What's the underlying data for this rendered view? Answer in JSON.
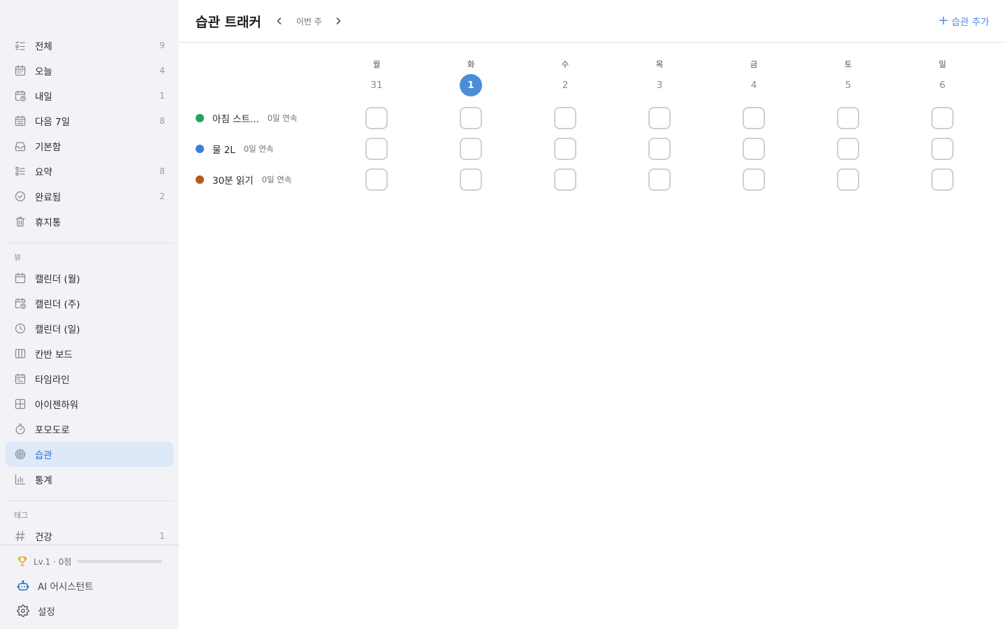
{
  "sidebar": {
    "smart_lists": [
      {
        "label": "전체",
        "count": "9",
        "icon": "checklist-icon"
      },
      {
        "label": "오늘",
        "count": "4",
        "icon": "calendar-today-icon"
      },
      {
        "label": "내일",
        "count": "1",
        "icon": "calendar-clock-icon"
      },
      {
        "label": "다음 7일",
        "count": "8",
        "icon": "calendar-week-icon"
      },
      {
        "label": "기본함",
        "count": "",
        "icon": "inbox-icon"
      },
      {
        "label": "요약",
        "count": "8",
        "icon": "list-icon"
      },
      {
        "label": "완료됨",
        "count": "2",
        "icon": "check-circle-icon"
      },
      {
        "label": "휴지통",
        "count": "",
        "icon": "trash-icon"
      }
    ],
    "views_label": "뷰",
    "views": [
      {
        "label": "캘린더 (월)",
        "icon": "calendar-month-icon"
      },
      {
        "label": "캘린더 (주)",
        "icon": "calendar-week-clock-icon"
      },
      {
        "label": "캘린더 (일)",
        "icon": "clock-icon"
      },
      {
        "label": "칸반 보드",
        "icon": "kanban-icon"
      },
      {
        "label": "타임라인",
        "icon": "timeline-icon"
      },
      {
        "label": "아이젠하워",
        "icon": "matrix-icon"
      },
      {
        "label": "포모도로",
        "icon": "timer-icon"
      },
      {
        "label": "습관",
        "icon": "target-icon",
        "active": true
      },
      {
        "label": "통계",
        "icon": "bar-chart-icon"
      }
    ],
    "tags_label": "태그",
    "tags": [
      {
        "label": "건강",
        "count": "1"
      }
    ],
    "level": {
      "text": "Lv.1 · 0점",
      "progress": 0
    },
    "assistant_label": "AI 어시스턴트",
    "settings_label": "설정"
  },
  "header": {
    "title": "습관 트래커",
    "week_label": "이번 주",
    "add_label": "습관 추가"
  },
  "week": {
    "days": [
      {
        "name": "월",
        "date": "31",
        "today": false
      },
      {
        "name": "화",
        "date": "1",
        "today": true
      },
      {
        "name": "수",
        "date": "2",
        "today": false
      },
      {
        "name": "목",
        "date": "3",
        "today": false
      },
      {
        "name": "금",
        "date": "4",
        "today": false
      },
      {
        "name": "토",
        "date": "5",
        "today": false
      },
      {
        "name": "일",
        "date": "6",
        "today": false
      }
    ]
  },
  "habits": [
    {
      "name": "아침 스트...",
      "streak": "0일 연속",
      "color": "#22a55a",
      "checks": [
        false,
        false,
        false,
        false,
        false,
        false,
        false
      ]
    },
    {
      "name": "물 2L",
      "streak": "0일 연속",
      "color": "#3a7fdc",
      "checks": [
        false,
        false,
        false,
        false,
        false,
        false,
        false
      ]
    },
    {
      "name": "30분 읽기",
      "streak": "0일 연속",
      "color": "#b85a1e",
      "checks": [
        false,
        false,
        false,
        false,
        false,
        false,
        false
      ]
    }
  ],
  "colors": {
    "accent": "#4a8ed8",
    "active_bg": "#dde8f8"
  }
}
